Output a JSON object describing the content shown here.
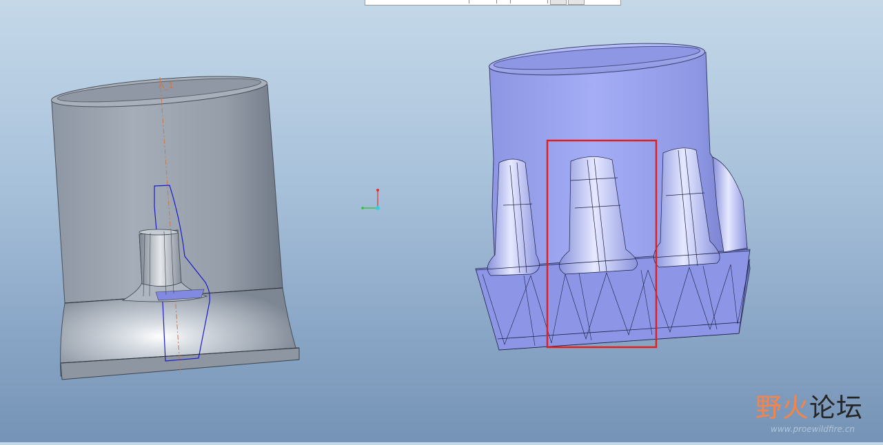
{
  "scene": {
    "datum_axis_label": "A_1",
    "colors": {
      "background_top": "#c4d8e8",
      "background_bottom": "#7593b6",
      "left_model": "#9aa3b0",
      "right_model": "#9aa4ee",
      "highlight_box": "#e0201c",
      "datum_axis": "#c87a4a",
      "edge_highlight": "#1a1ac8"
    }
  },
  "watermark": {
    "part1": "野火",
    "part2": "论坛",
    "url": "www.proewildfire.cn"
  }
}
